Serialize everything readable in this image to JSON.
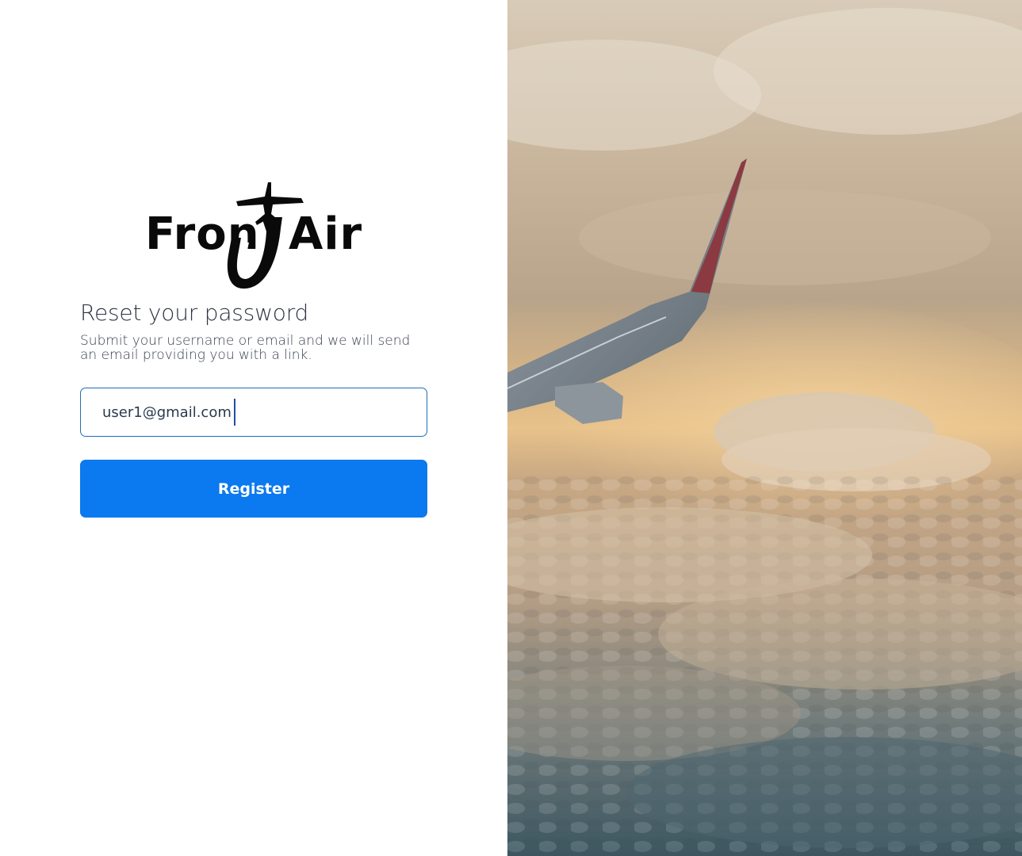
{
  "brand": {
    "logo_text": "FronJAir",
    "logo_part_left": "Fron",
    "logo_part_right": "Air"
  },
  "form": {
    "title": "Reset your password",
    "subtitle": "Submit your username or email and we will send an email providing you with a link.",
    "email_value": "user1@gmail.com",
    "submit_label": "Register"
  },
  "colors": {
    "accent": "#0b79ef",
    "field_border": "#1f6fb5",
    "text": "#2f3442"
  },
  "image": {
    "subject": "airplane-wing-above-clouds"
  }
}
